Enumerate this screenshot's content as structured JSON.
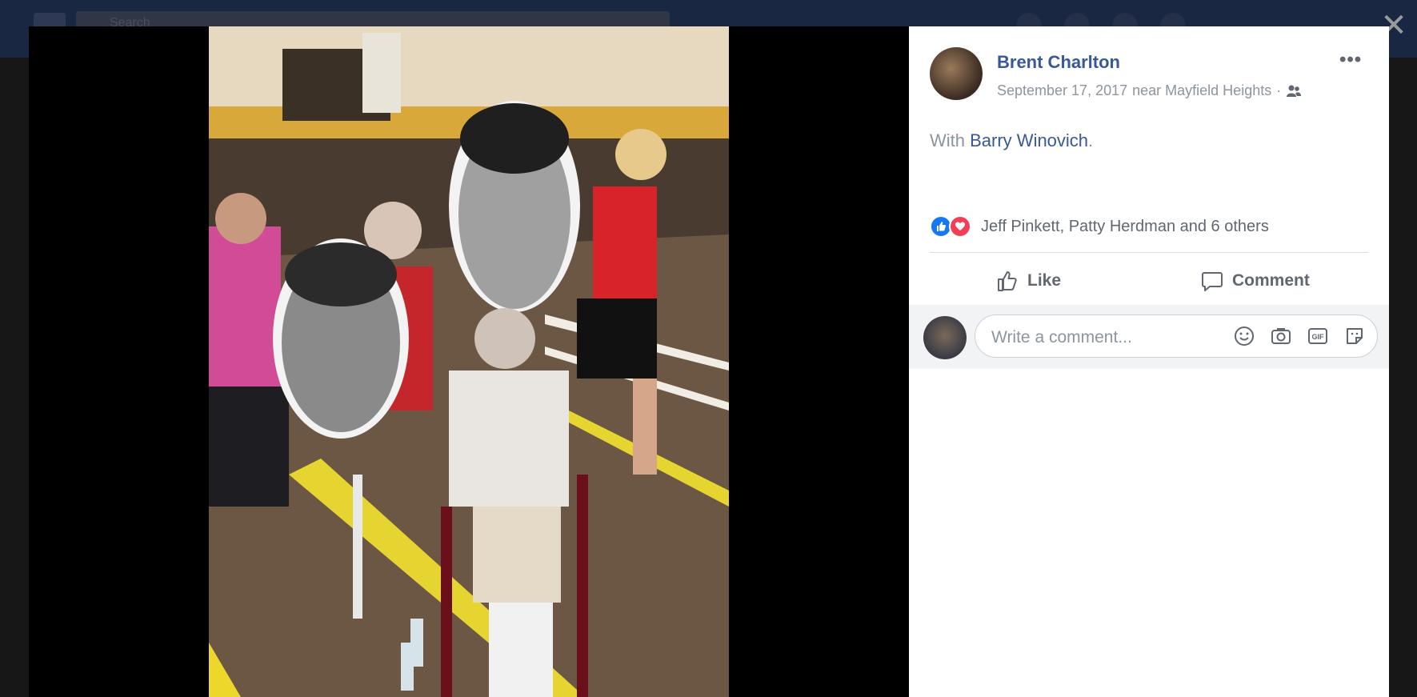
{
  "topbar": {
    "search_placeholder": "Search"
  },
  "overlay": {
    "close_label": "✕"
  },
  "post": {
    "author": "Brent Charlton",
    "date": "September 17, 2017",
    "location": "near Mayfield Heights",
    "audience_icon": "friends-icon",
    "with_prefix": "With ",
    "with_name": "Barry Winovich",
    "with_suffix": ".",
    "more_label": "•••",
    "reaction_summary": "Jeff Pinkett, Patty Herdman and 6 others",
    "reaction_icons": [
      "like-icon",
      "love-icon"
    ]
  },
  "actions": {
    "like_label": "Like",
    "comment_label": "Comment"
  },
  "comment_box": {
    "placeholder": "Write a comment...",
    "icons": [
      "emoji-icon",
      "camera-icon",
      "gif-icon",
      "sticker-icon"
    ]
  },
  "colors": {
    "brand": "#385898",
    "like_blue": "#1877f2",
    "love_red": "#f33e58",
    "muted": "#8d949e"
  }
}
